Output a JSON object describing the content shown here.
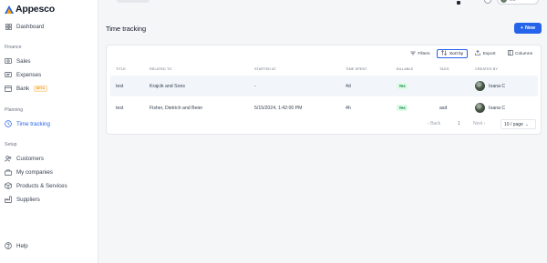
{
  "app": {
    "name": "Appesco"
  },
  "sidebar": {
    "dashboard": "Dashboard",
    "sections": {
      "finance": "Finance",
      "planning": "Planning",
      "setup": "Setup"
    },
    "finance_items": [
      {
        "label": "Sales",
        "icon": "cash-icon"
      },
      {
        "label": "Expenses",
        "icon": "receipt-icon"
      },
      {
        "label": "Bank",
        "icon": "bank-icon",
        "badge": "BETA"
      }
    ],
    "planning_items": [
      {
        "label": "Time tracking",
        "icon": "clock-icon",
        "active": true
      }
    ],
    "setup_items": [
      {
        "label": "Customers",
        "icon": "users-icon"
      },
      {
        "label": "My companies",
        "icon": "building-icon"
      },
      {
        "label": "Products & Services",
        "icon": "box-icon"
      },
      {
        "label": "Suppliers",
        "icon": "factory-icon"
      }
    ],
    "help": "Help"
  },
  "topbar": {
    "user_label": "test"
  },
  "main": {
    "title": "Time tracking",
    "new_button": "New",
    "toolbar": {
      "filters": "Filters",
      "sort_by": "Sort by",
      "export": "Export",
      "columns": "Columns"
    },
    "table": {
      "headers": {
        "title": "Title",
        "related_to": "Related to",
        "started_at": "Started at",
        "time_spent": "Time spent",
        "billable": "Billable",
        "tags": "Tags",
        "created_by": "Created by"
      },
      "rows": [
        {
          "title": "test",
          "related_to": "Krajcik and Sons",
          "started_at": "-",
          "time_spent": "4d",
          "billable": "Yes",
          "tags": "",
          "created_by": "Ioana C"
        },
        {
          "title": "test",
          "related_to": "Fisher, Dietrich and Beier",
          "started_at": "5/15/2024, 1:42:00 PM",
          "time_spent": "4h",
          "billable": "Yes",
          "tags": "asd",
          "created_by": "Ioana C"
        }
      ]
    },
    "pagination": {
      "back": "Back",
      "page": "1",
      "next": "Next",
      "per_page": "10 / page"
    }
  },
  "colors": {
    "accent": "#2563eb",
    "billable_bg": "#dcfce7",
    "billable_text": "#15803d"
  }
}
